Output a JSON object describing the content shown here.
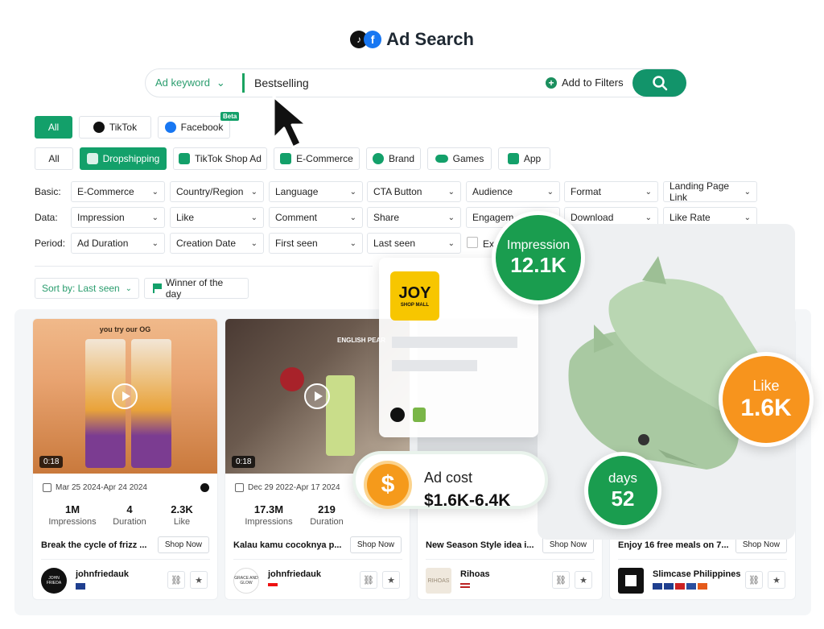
{
  "header": {
    "title": "Ad Search"
  },
  "search": {
    "keyword_type": "Ad keyword",
    "value": "Bestselling",
    "add_filters": "Add to Filters"
  },
  "platforms": [
    {
      "label": "All",
      "active": true
    },
    {
      "label": "TikTok",
      "active": false
    },
    {
      "label": "Facebook",
      "active": false,
      "badge": "Beta"
    }
  ],
  "categories": [
    {
      "label": "All",
      "active": false
    },
    {
      "label": "Dropshipping",
      "active": true
    },
    {
      "label": "TikTok Shop Ad",
      "active": false
    },
    {
      "label": "E-Commerce",
      "active": false
    },
    {
      "label": "Brand",
      "active": false
    },
    {
      "label": "Games",
      "active": false
    },
    {
      "label": "App",
      "active": false
    }
  ],
  "filters": {
    "basic_label": "Basic:",
    "data_label": "Data:",
    "period_label": "Period:",
    "basic": [
      "E-Commerce",
      "Country/Region",
      "Language",
      "CTA Button",
      "Audience",
      "Format",
      "Landing Page Link"
    ],
    "data": [
      "Impression",
      "Like",
      "Comment",
      "Share",
      "Engagem",
      "Download",
      "Like Rate"
    ],
    "period": [
      "Ad Duration",
      "Creation Date",
      "First seen",
      "Last seen"
    ],
    "checkbox_label": "Ex"
  },
  "sort": {
    "label": "Sort by: Last seen",
    "winner": "Winner of the day"
  },
  "cards": [
    {
      "thumb_text": "you try our OG",
      "duration_badge": "0:18",
      "date": "Mar 25 2024-Apr 24 2024",
      "impressions": "1M",
      "impressions_label": "Impressions",
      "duration": "4",
      "duration_label": "Duration",
      "likes": "2.3K",
      "likes_label": "Like",
      "title": "Break the cycle of frizz ...",
      "cta": "Shop Now",
      "advertiser": "johnfriedauk",
      "avatar_text": "JOHN FRIEDA"
    },
    {
      "thumb_text": "ENGLISH PEAR",
      "duration_badge": "0:18",
      "date": "Dec 29 2022-Apr 17 2024",
      "impressions": "17.3M",
      "impressions_label": "Impressions",
      "duration": "219",
      "duration_label": "Duration",
      "title": "Kalau kamu cocoknya p...",
      "cta": "Shop Now",
      "advertiser": "johnfriedauk",
      "avatar_text": "GRACE AND GLOW"
    },
    {
      "title": "New Season Style idea i...",
      "cta": "Shop Now",
      "advertiser": "Rihoas",
      "avatar_text": "RIHOAS"
    },
    {
      "title": "Enjoy 16 free meals on 7...",
      "cta": "Shop Now",
      "advertiser": "Slimcase Philippines"
    }
  ],
  "popup": {
    "brand_logo": "JOY",
    "brand_sub": "SHOP MALL"
  },
  "overlays": {
    "impression": {
      "label": "Impression",
      "value": "12.1K",
      "color": "#1a9d4f"
    },
    "like": {
      "label": "Like",
      "value": "1.6K",
      "color": "#f7941d"
    },
    "days": {
      "label": "days",
      "value": "52",
      "color": "#1a9d4f"
    },
    "ad_cost": {
      "label": "Ad cost",
      "value": "$1.6K-6.4K",
      "symbol": "$"
    }
  },
  "colors": {
    "accent": "#13a06a",
    "orange": "#f7941d"
  }
}
